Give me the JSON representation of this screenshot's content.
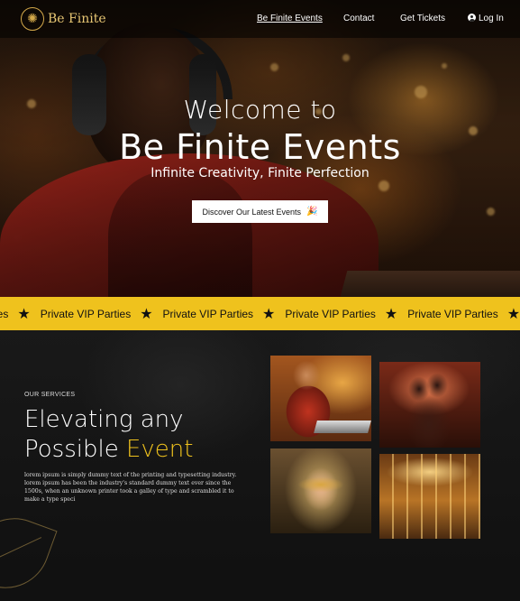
{
  "nav": {
    "logo_text": "Be Finite",
    "links": [
      {
        "label": "Be Finite Events",
        "active": true
      },
      {
        "label": "Contact"
      },
      {
        "label": "Get Tickets"
      },
      {
        "label": "Log In",
        "icon": "user-circle-icon"
      }
    ]
  },
  "hero": {
    "line1": "Welcome to",
    "line2": "Be Finite Events",
    "tagline": "Infinite Creativity, Finite Perfection",
    "cta_label": "Discover Our Latest Events",
    "cta_icon": "party-popper-icon"
  },
  "ticker": {
    "items": [
      "Parties",
      "Private VIP Parties",
      "Private VIP Parties",
      "Private VIP Parties",
      "Private VIP Parties"
    ],
    "separator_icon": "star-icon",
    "background": "#efc21d"
  },
  "services": {
    "label": "OUR SERVICES",
    "title_line1": "Elevating any",
    "title_line2_prefix": "Possible ",
    "title_line2_accent": "Event",
    "body": "lorem ipsum is simply dummy text of the printing and typesetting industry. lorem ipsum has been the industry's standard dummy text ever since the 1500s, when an unknown printer took a galley of type and scrambled it to make a type speci",
    "accent_color": "#efc21d"
  },
  "colors": {
    "gold": "#e8c774",
    "yellow": "#efc21d",
    "dark": "#111111"
  }
}
